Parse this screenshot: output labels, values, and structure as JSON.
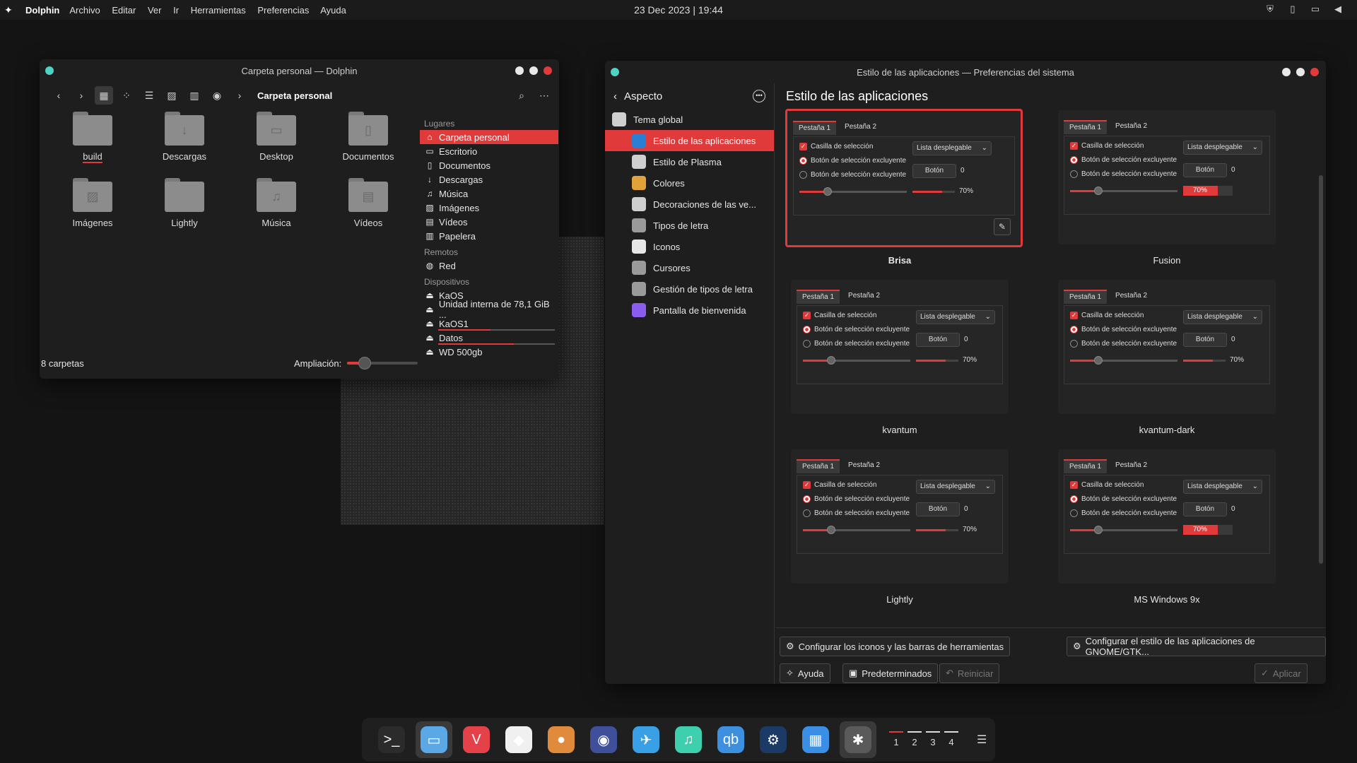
{
  "topbar": {
    "app": "Dolphin",
    "menu": [
      "Archivo",
      "Editar",
      "Ver",
      "Ir",
      "Herramientas",
      "Preferencias",
      "Ayuda"
    ],
    "clock": "23 Dec 2023 | 19:44",
    "tray_icons": [
      "shield-icon",
      "clipboard-icon",
      "network-icon",
      "volume-icon"
    ]
  },
  "dolphin": {
    "title": "Carpeta personal — Dolphin",
    "breadcrumb": "Carpeta personal",
    "folders": [
      {
        "name": "build",
        "icon": "folder-icon"
      },
      {
        "name": "Descargas",
        "icon": "download-folder-icon"
      },
      {
        "name": "Desktop",
        "icon": "desktop-folder-icon"
      },
      {
        "name": "Documentos",
        "icon": "documents-folder-icon"
      },
      {
        "name": "Imágenes",
        "icon": "pictures-folder-icon"
      },
      {
        "name": "Lightly",
        "icon": "folder-icon"
      },
      {
        "name": "Música",
        "icon": "music-folder-icon"
      },
      {
        "name": "Vídeos",
        "icon": "videos-folder-icon"
      }
    ],
    "places_header": "Lugares",
    "places": [
      "Carpeta personal",
      "Escritorio",
      "Documentos",
      "Descargas",
      "Música",
      "Imágenes",
      "Vídeos",
      "Papelera"
    ],
    "remote_header": "Remotos",
    "remote": [
      "Red"
    ],
    "devices_header": "Dispositivos",
    "devices": [
      {
        "name": "KaOS",
        "usage": null
      },
      {
        "name": "Unidad interna de 78,1 GiB ...",
        "usage": null
      },
      {
        "name": "KaOS1",
        "usage": 0.45
      },
      {
        "name": "Datos",
        "usage": 0.65
      },
      {
        "name": "WD 500gb",
        "usage": null
      }
    ],
    "status": "8 carpetas",
    "zoom_label": "Ampliación:",
    "zoom_level": 0.25
  },
  "settings": {
    "title": "Estilo de las aplicaciones — Preferencias del sistema",
    "back_label": "Aspecto",
    "sidebar": [
      {
        "label": "Tema global",
        "color": "#cfcfcf",
        "icon": "theme-icon"
      },
      {
        "label": "Estilo de las aplicaciones",
        "color": "#2a7fd4",
        "icon": "app-style-icon"
      },
      {
        "label": "Estilo de Plasma",
        "color": "#cfcfcf",
        "icon": "plasma-icon"
      },
      {
        "label": "Colores",
        "color": "#e2a23a",
        "icon": "colors-icon"
      },
      {
        "label": "Decoraciones de las ve...",
        "color": "#cfcfcf",
        "icon": "window-decoration-icon"
      },
      {
        "label": "Tipos de letra",
        "color": "#9a9a9a",
        "icon": "fonts-icon"
      },
      {
        "label": "Iconos",
        "color": "#e6e6e6",
        "icon": "icons-icon"
      },
      {
        "label": "Cursores",
        "color": "#9a9a9a",
        "icon": "cursor-icon"
      },
      {
        "label": "Gestión de tipos de letra",
        "color": "#9a9a9a",
        "icon": "font-manager-icon"
      },
      {
        "label": "Pantalla de bienvenida",
        "color": "#8a5cf0",
        "icon": "splash-icon"
      }
    ],
    "heading": "Estilo de las aplicaciones",
    "preview_text": {
      "tab1": "Pestaña 1",
      "tab2": "Pestaña 2",
      "checkbox": "Casilla de selección",
      "radio": "Botón de selección excluyente",
      "combo": "Lista desplegable",
      "button": "Botón",
      "spin": "0",
      "pct": "70%"
    },
    "styles": [
      "Brisa",
      "Fusion",
      "kvantum",
      "kvantum-dark",
      "Lightly",
      "MS Windows 9x"
    ],
    "selected_style": "Brisa",
    "buttons": {
      "icons_toolbars": "Configurar los iconos y las barras de herramientas",
      "gtk": "Configurar el estilo de las aplicaciones de GNOME/GTK...",
      "help": "Ayuda",
      "defaults": "Predeterminados",
      "reset": "Reiniciar",
      "apply": "Aplicar"
    }
  },
  "dock": {
    "apps": [
      {
        "icon": "terminal-icon",
        "color": "#2b2b2b",
        "glyph": ">_"
      },
      {
        "icon": "file-manager-icon",
        "color": "#5aa9e6",
        "glyph": "▭"
      },
      {
        "icon": "vivaldi-icon",
        "color": "#e5414a",
        "glyph": "V"
      },
      {
        "icon": "inkscape-icon",
        "color": "#f0f0f0",
        "glyph": "◆"
      },
      {
        "icon": "gimp-icon",
        "color": "#e08a3c",
        "glyph": "●"
      },
      {
        "icon": "audio-app-icon",
        "color": "#3f4f9a",
        "glyph": "◉"
      },
      {
        "icon": "kdeconnect-icon",
        "color": "#3aa0e6",
        "glyph": "✈"
      },
      {
        "icon": "music-icon",
        "color": "#3ecfae",
        "glyph": "♫"
      },
      {
        "icon": "qbittorrent-icon",
        "color": "#3d8fe0",
        "glyph": "qb"
      },
      {
        "icon": "steam-icon",
        "color": "#1b3a66",
        "glyph": "⚙"
      },
      {
        "icon": "discover-icon",
        "color": "#3a8ee6",
        "glyph": "▦"
      },
      {
        "icon": "system-settings-icon",
        "color": "#5a5a5a",
        "glyph": "✱"
      }
    ],
    "desktops": [
      "1",
      "2",
      "3",
      "4"
    ],
    "current_desktop": "1"
  }
}
